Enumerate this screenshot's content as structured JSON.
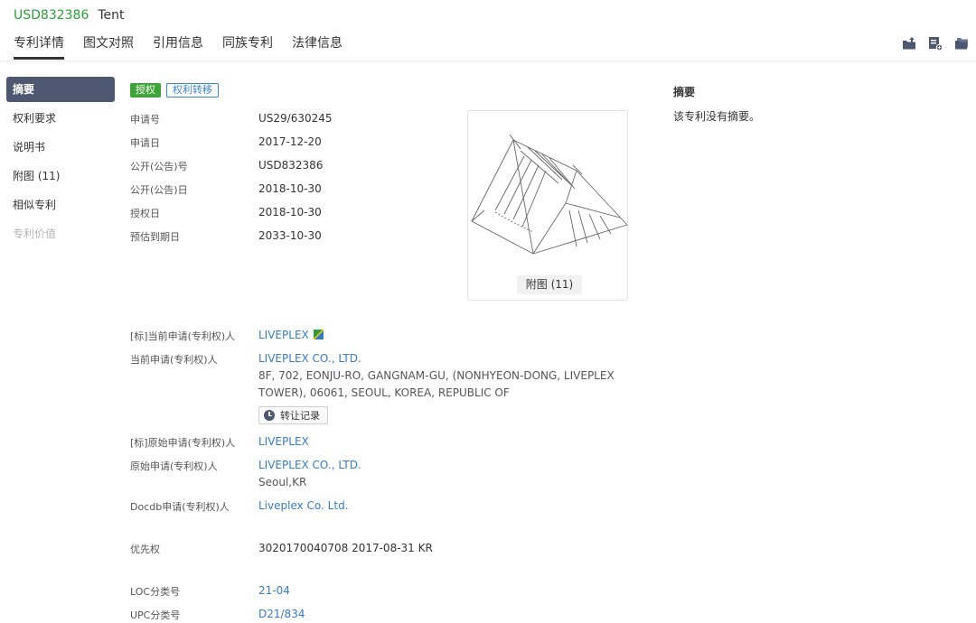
{
  "header": {
    "patent_number": "USD832386",
    "patent_title": "Tent",
    "tabs": [
      "专利详情",
      "图文对照",
      "引用信息",
      "同族专利",
      "法律信息"
    ],
    "tools": [
      "export-icon",
      "add-bookmark-icon",
      "folder-icon"
    ]
  },
  "sidebar": {
    "items": [
      {
        "label": "摘要"
      },
      {
        "label": "权利要求"
      },
      {
        "label": "说明书"
      },
      {
        "label": "附图 (11)"
      },
      {
        "label": "相似专利"
      },
      {
        "label": "专利价值"
      }
    ]
  },
  "badges": {
    "status": "授权",
    "transfer": "权利转移"
  },
  "details": {
    "application_no_label": "申请号",
    "application_no": "US29/630245",
    "application_date_label": "申请日",
    "application_date": "2017-12-20",
    "publication_no_label": "公开(公告)号",
    "publication_no": "USD832386",
    "publication_date_label": "公开(公告)日",
    "publication_date": "2018-10-30",
    "grant_date_label": "授权日",
    "grant_date": "2018-10-30",
    "expiry_label": "预估到期日",
    "expiry_date": "2033-10-30"
  },
  "drawing": {
    "button_label": "附图 (11)"
  },
  "applicants": {
    "std_current_label": "[标]当前申请(专利权)人",
    "std_current_value": "LIVEPLEX",
    "current_label": "当前申请(专利权)人",
    "current_value": "LIVEPLEX CO., LTD.",
    "current_address": "8F, 702, EONJU-RO, GANGNAM-GU, (NONHYEON-DONG, LIVEPLEX TOWER), 06061, SEOUL, KOREA, REPUBLIC OF",
    "transfer_button": "转让记录",
    "std_original_label": "[标]原始申请(专利权)人",
    "std_original_value": "LIVEPLEX",
    "original_label": "原始申请(专利权)人",
    "original_value": "LIVEPLEX CO., LTD.",
    "original_location": "Seoul,KR",
    "docdb_label": "Docdb申请(专利权)人",
    "docdb_value": "Liveplex Co. Ltd."
  },
  "priority": {
    "label": "优先权",
    "value": "3020170040708 2017-08-31 KR"
  },
  "classification": {
    "loc_label": "LOC分类号",
    "loc_value": "21-04",
    "upc_label": "UPC分类号",
    "upc_value": "D21/834"
  },
  "abstract": {
    "title": "摘要",
    "text": "该专利没有摘要。"
  },
  "colors": {
    "patent_number": "#2e9b3c",
    "link": "#3a7bbf",
    "sidebar_active": "#4d5870",
    "badge_green": "#3fa33a"
  }
}
